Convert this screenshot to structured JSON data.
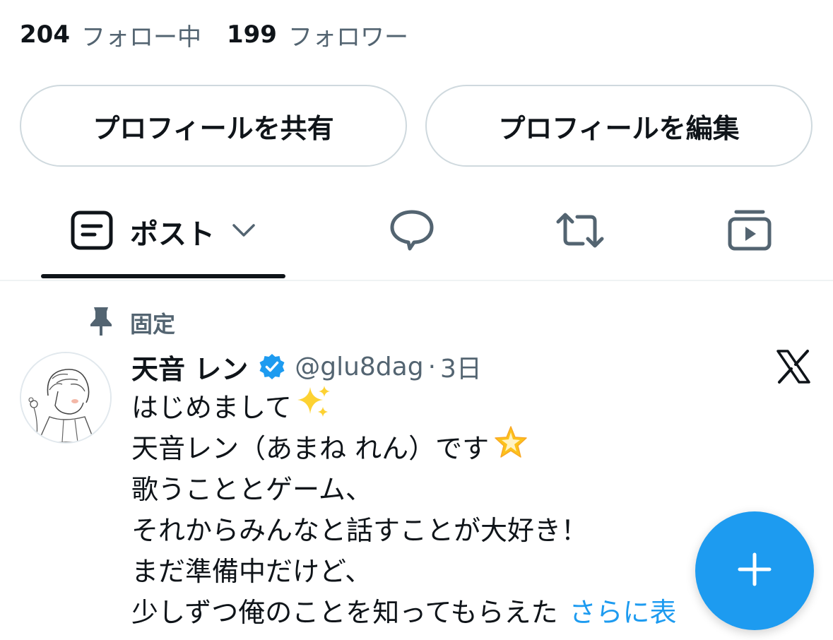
{
  "follow": {
    "following_count": "204",
    "following_label": "フォロー中",
    "followers_count": "199",
    "followers_label": "フォロワー"
  },
  "profile_buttons": {
    "share": "プロフィールを共有",
    "edit": "プロフィールを編集"
  },
  "tabs": {
    "posts_label": "ポスト",
    "icons": [
      "posts-icon",
      "reply-icon",
      "repost-icon",
      "media-icon"
    ]
  },
  "pinned": {
    "label": "固定"
  },
  "tweet": {
    "author_name": "天音 レン",
    "handle": "@glu8dag",
    "separator": "·",
    "time": "3日",
    "lines": [
      "はじめまして",
      "天音レン（あまね れん）です",
      "歌うこととゲーム、",
      "それからみんなと話すことが大好き！",
      "まだ準備中だけど、",
      "少しずつ俺のことを知ってもらえた"
    ],
    "more_link": "さらに表",
    "emojis": [
      "sparkles-emoji",
      "glowing-star-emoji"
    ]
  },
  "colors": {
    "accent": "#1d9bf0",
    "text_primary": "#0f1419",
    "text_secondary": "#536471",
    "border": "#cfd9de"
  }
}
